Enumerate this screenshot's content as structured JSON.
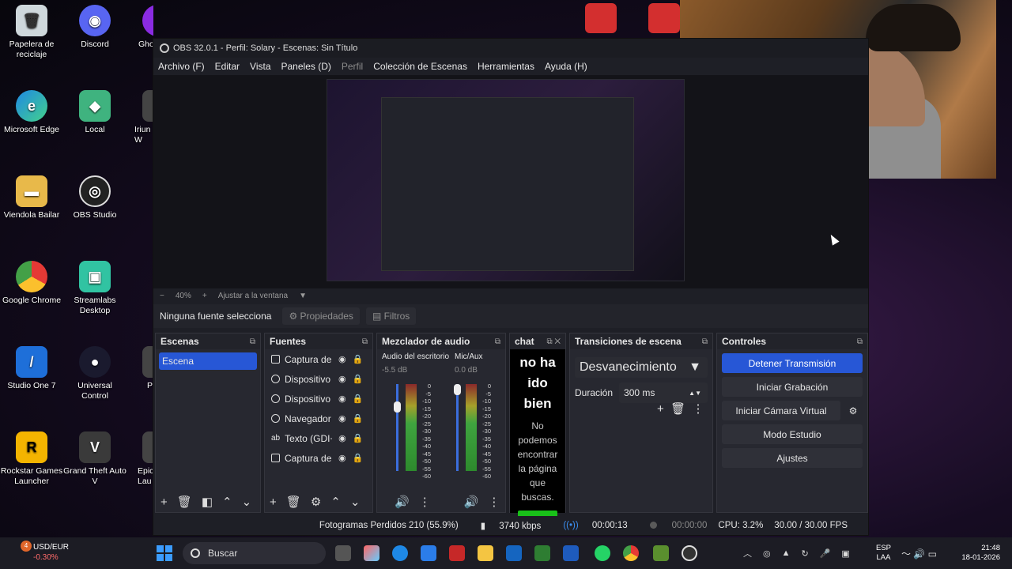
{
  "desktop_icons": [
    {
      "label": "Papelera de reciclaje",
      "color": "#d9d9d9",
      "glyph": "🗑"
    },
    {
      "label": "Discord",
      "color": "#5865f2",
      "glyph": "◉"
    },
    {
      "label": "Microsoft Edge",
      "color": "#1e88e5",
      "glyph": "e"
    },
    {
      "label": "Local",
      "color": "#3fb37f",
      "glyph": "◆"
    },
    {
      "label": "Viendola Bailar",
      "color": "#e8b94a",
      "glyph": "▬"
    },
    {
      "label": "OBS Studio",
      "color": "#222222",
      "glyph": "◎"
    },
    {
      "label": "Google Chrome",
      "color": "#e53935",
      "glyph": "●"
    },
    {
      "label": "Streamlabs Desktop",
      "color": "#31c3a2",
      "glyph": "▣"
    },
    {
      "label": "Studio One 7",
      "color": "#1e6fd9",
      "glyph": "/"
    },
    {
      "label": "Universal Control",
      "color": "#1a1a2e",
      "glyph": "●"
    },
    {
      "label": "Rockstar Games Launcher",
      "color": "#f4b400",
      "glyph": "R"
    },
    {
      "label": "Grand Theft Auto V",
      "color": "#3a3a3a",
      "glyph": "V"
    },
    {
      "label": "Gho",
      "color": "#8a2be2",
      "glyph": ""
    },
    {
      "label": "Iriun W",
      "color": "#444",
      "glyph": ""
    },
    {
      "label": "P",
      "color": "#444",
      "glyph": ""
    },
    {
      "label": "Epic Lau",
      "color": "#444",
      "glyph": ""
    }
  ],
  "obs": {
    "title": "OBS 32.0.1 - Perfil: Solary - Escenas: Sin Título",
    "menu": [
      "Archivo (F)",
      "Editar",
      "Vista",
      "Paneles (D)",
      "Perfil",
      "Colección de Escenas",
      "Herramientas",
      "Ayuda (H)"
    ],
    "zoom": "40%",
    "zoom_plus": "+",
    "zoom_minus": "−",
    "fit": "Ajustar a la ventana",
    "no_source": "Ninguna fuente selecciona",
    "properties": "Propiedades",
    "filters": "Filtros",
    "scenes": {
      "title": "Escenas",
      "items": [
        "Escena"
      ]
    },
    "sources": {
      "title": "Fuentes",
      "items": [
        {
          "label": "Captura de p",
          "locked": false
        },
        {
          "label": "Dispositivo d",
          "locked": true
        },
        {
          "label": "Dispositivo d",
          "locked": true
        },
        {
          "label": "Navegador",
          "locked": false
        },
        {
          "label": "Texto (GDI+)",
          "locked": true
        },
        {
          "label": "Captura de p",
          "locked": true
        }
      ]
    },
    "mixer": {
      "title": "Mezclador de audio",
      "channels": [
        {
          "name": "Audio del escritorio",
          "db": "-5.5 dB"
        },
        {
          "name": "Mic/Aux",
          "db": "0.0 dB"
        }
      ],
      "ticks": [
        "0",
        "-5",
        "-10",
        "-15",
        "-20",
        "-25",
        "-30",
        "-35",
        "-40",
        "-45",
        "-50",
        "-55",
        "-60"
      ]
    },
    "chat": {
      "title": "chat",
      "heading": "no ha ido bien",
      "message": "No podemos encontrar la página que buscas."
    },
    "transitions": {
      "title": "Transiciones de escena",
      "selected": "Desvanecimiento",
      "duration_label": "Duración",
      "duration_value": "300 ms"
    },
    "controls": {
      "title": "Controles",
      "stop_stream": "Detener Transmisión",
      "start_record": "Iniciar Grabación",
      "virtual_cam": "Iniciar Cámara Virtual",
      "studio_mode": "Modo Estudio",
      "settings": "Ajustes"
    },
    "status": {
      "dropped": "Fotogramas Perdidos 210 (55.9%)",
      "bitrate": "3740 kbps",
      "stream_time": "00:00:13",
      "rec_time": "00:00:00",
      "cpu": "CPU: 3.2%",
      "fps": "30.00 / 30.00 FPS"
    }
  },
  "taskbar": {
    "ticker_name": "USD/EUR",
    "ticker_value": "-0.30%",
    "ticker_badge": "4",
    "search": "Buscar",
    "lang_1": "ESP",
    "lang_2": "LAA",
    "time": "21:48",
    "date": "18-01-2026"
  }
}
